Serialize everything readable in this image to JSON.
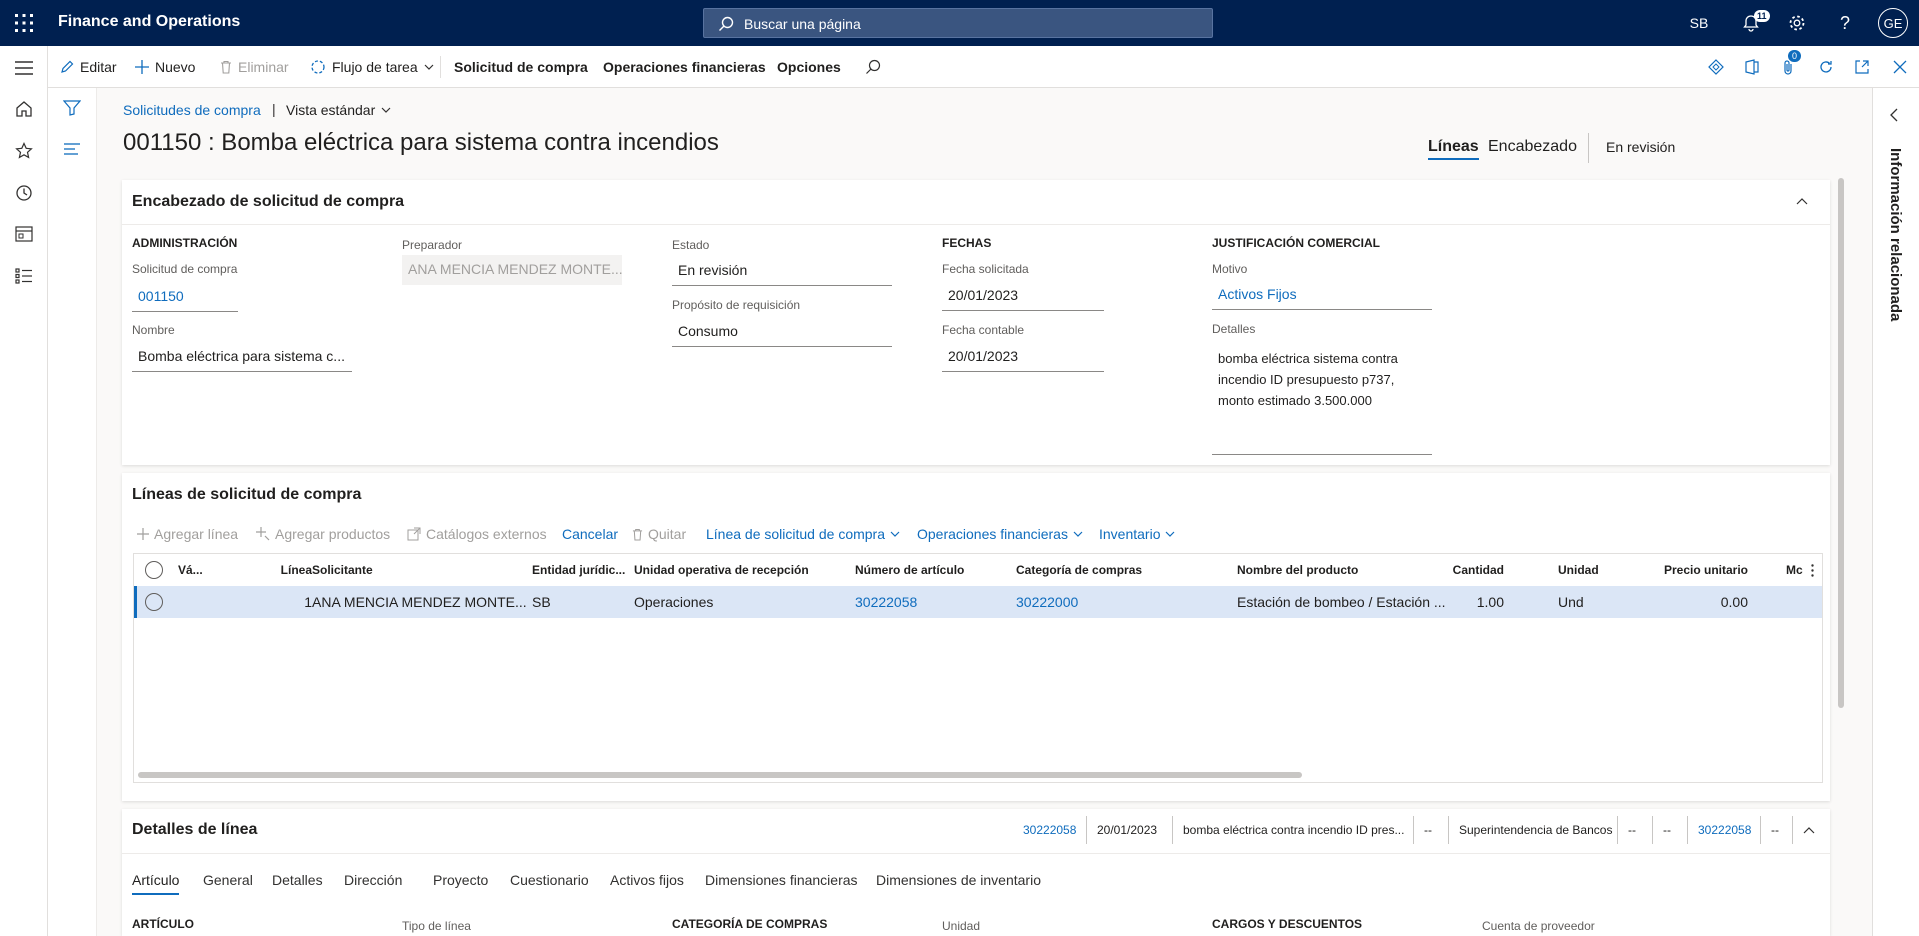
{
  "topbar": {
    "app_name": "Finance and Operations",
    "search_placeholder": "Buscar una página",
    "company": "SB",
    "notifications_count": "11",
    "avatar_initials": "GE"
  },
  "action_pane": {
    "edit": "Editar",
    "new": "Nuevo",
    "delete": "Eliminar",
    "workflow": "Flujo de tarea",
    "purchase_req": "Solicitud de compra",
    "financials": "Operaciones financieras",
    "options": "Opciones",
    "attachments_count": "0"
  },
  "breadcrumb": {
    "link": "Solicitudes de compra",
    "view": "Vista estándar"
  },
  "page": {
    "title": "001150 : Bomba eléctrica para sistema contra incendios",
    "tab_lines": "Líneas",
    "tab_header": "Encabezado",
    "status": "En revisión"
  },
  "right_panel": {
    "title": "Información relacionada"
  },
  "header_card": {
    "title": "Encabezado de solicitud de compra",
    "admin": {
      "group": "ADMINISTRACIÓN",
      "req_label": "Solicitud de compra",
      "req_value": "001150",
      "name_label": "Nombre",
      "name_value": "Bomba eléctrica para sistema c..."
    },
    "preparer": {
      "label": "Preparador",
      "value": "ANA MENCIA MENDEZ MONTE..."
    },
    "state": {
      "label": "Estado",
      "value": "En revisión",
      "purpose_label": "Propósito de requisición",
      "purpose_value": "Consumo"
    },
    "dates": {
      "group": "FECHAS",
      "requested_label": "Fecha solicitada",
      "requested_value": "20/01/2023",
      "accounting_label": "Fecha contable",
      "accounting_value": "20/01/2023"
    },
    "justification": {
      "group": "JUSTIFICACIÓN COMERCIAL",
      "reason_label": "Motivo",
      "reason_value": "Activos Fijos",
      "details_label": "Detalles",
      "details_value": "bomba eléctrica sistema contra incendio ID presupuesto p737, monto estimado 3.500.000"
    }
  },
  "lines_card": {
    "title": "Líneas de solicitud de compra",
    "toolbar": {
      "add_line": "Agregar línea",
      "add_products": "Agregar productos",
      "external_catalogs": "Catálogos externos",
      "cancel": "Cancelar",
      "remove": "Quitar",
      "line_menu": "Línea de solicitud de compra",
      "financials_menu": "Operaciones financieras",
      "inventory_menu": "Inventario"
    },
    "columns": [
      "Vá...",
      "Línea",
      "Solicitante",
      "Entidad jurídic...",
      "Unidad operativa de recepción",
      "Número de artículo",
      "Categoría de compras",
      "Nombre del producto",
      "Cantidad",
      "Unidad",
      "Precio unitario",
      "Mc"
    ],
    "rows": [
      {
        "line": "1",
        "requester": "ANA MENCIA MENDEZ MONTE...",
        "entity": "SB",
        "operating_unit": "Operaciones",
        "item_number": "30222058",
        "category": "30222000",
        "product_name": "Estación de bombeo / Estación ...",
        "quantity": "1.00",
        "unit": "Und",
        "unit_price": "0.00"
      }
    ]
  },
  "details_card": {
    "title": "Detalles de línea",
    "summary": [
      "30222058",
      "20/01/2023",
      "bomba eléctrica contra incendio ID pres...",
      "--",
      "Superintendencia de Bancos",
      "--",
      "--",
      "30222058",
      "--"
    ],
    "tabs": [
      "Artículo",
      "General",
      "Detalles",
      "Dirección",
      "Proyecto",
      "Cuestionario",
      "Activos fijos",
      "Dimensiones financieras",
      "Dimensiones de inventario"
    ],
    "sections": [
      "ARTÍCULO",
      "Tipo de línea",
      "CATEGORÍA DE COMPRAS",
      "Unidad",
      "CARGOS Y DESCUENTOS",
      "Cuenta de proveedor"
    ]
  }
}
